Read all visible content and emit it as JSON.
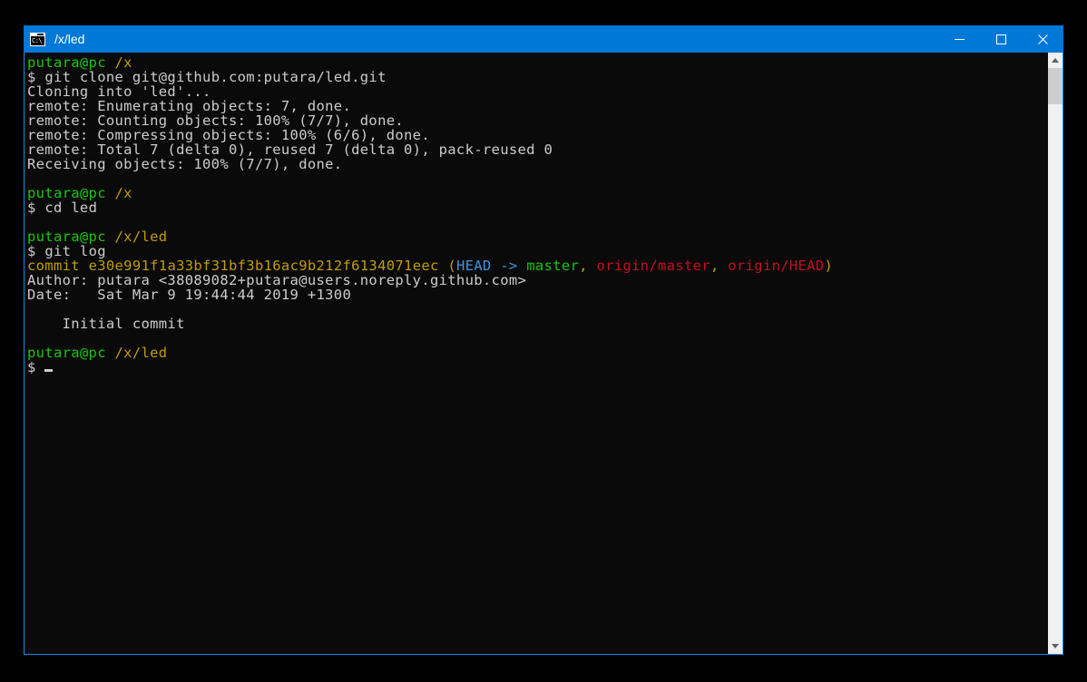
{
  "window": {
    "title": "/x/led",
    "icon_name": "cmd-icon",
    "icon_text": "C:\\_",
    "titlebar_color": "#0078d7",
    "border_color": "#1b8ae5",
    "background": "#0a0a0a",
    "controls": {
      "minimize": "–",
      "maximize": "□",
      "close": "✕"
    }
  },
  "colors": {
    "prompt_user": "#16c60c",
    "prompt_path": "#c19c00",
    "text": "#cccccc",
    "commit_hash": "#c19c00",
    "head_ref": "#3a96dd",
    "local_branch": "#16c60c",
    "remote_branch": "#c50f1f"
  },
  "terminal": {
    "prompt_user_host": "putara@pc",
    "prompt_symbol": "$",
    "cursor": "block-underscore-cursor",
    "blocks": [
      {
        "prompt_path": "/x",
        "command": "git clone git@github.com:putara/led.git",
        "output": [
          "Cloning into 'led'...",
          "remote: Enumerating objects: 7, done.",
          "remote: Counting objects: 100% (7/7), done.",
          "remote: Compressing objects: 100% (6/6), done.",
          "remote: Total 7 (delta 0), reused 7 (delta 0), pack-reused 0",
          "Receiving objects: 100% (7/7), done."
        ]
      },
      {
        "prompt_path": "/x",
        "command": "cd led",
        "output": []
      },
      {
        "prompt_path": "/x/led",
        "command": "git log",
        "commit": {
          "label": "commit",
          "hash": "e30e991f1a33bf31bf3b16ac9b212f6134071eec",
          "decoration": {
            "open_paren": "(",
            "head_arrow": "HEAD -> ",
            "local_branch": "master",
            "separator_1": ", ",
            "remote_master": "origin/master",
            "separator_2": ", ",
            "remote_head": "origin/HEAD",
            "close_paren": ")"
          }
        },
        "author_line": "Author: putara <38089082+putara@users.noreply.github.com>",
        "date_line": "Date:   Sat Mar 9 19:44:44 2019 +1300",
        "message": "    Initial commit"
      },
      {
        "prompt_path": "/x/led",
        "command": "",
        "output": []
      }
    ]
  },
  "scrollbar": {
    "up_arrow": "scroll-up-arrow",
    "down_arrow": "scroll-down-arrow",
    "thumb": "scroll-thumb"
  }
}
